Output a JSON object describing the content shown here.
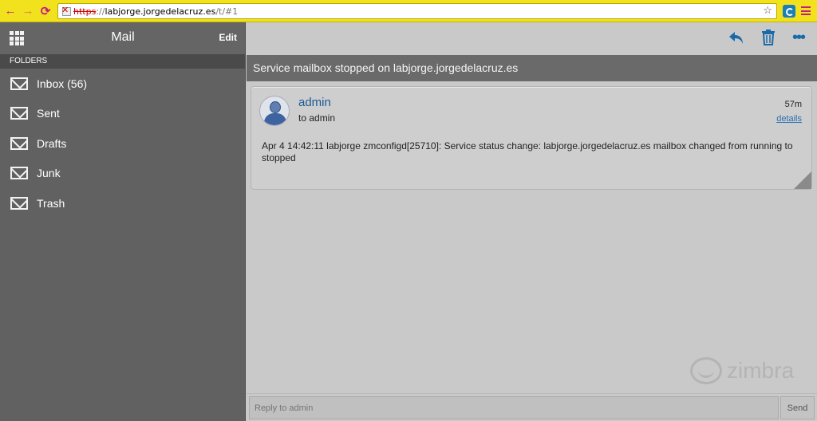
{
  "browser": {
    "url_scheme": "https",
    "url_sep": "://",
    "url_host": "labjorge.jorgedelacruz.es",
    "url_path": "/t/#1",
    "icons": [
      "back-arrow-icon",
      "forward-arrow-icon",
      "reload-icon",
      "security-warning-icon",
      "star-icon",
      "extension-icon",
      "menu-icon"
    ],
    "colors": {
      "chrome": "#f2e21e",
      "accent": "#c1207d"
    }
  },
  "sidebar": {
    "title": "Mail",
    "edit_label": "Edit",
    "folders_label": "FOLDERS",
    "folders": [
      {
        "label": "Inbox (56)",
        "icon": "envelope-icon"
      },
      {
        "label": "Sent",
        "icon": "envelope-icon"
      },
      {
        "label": "Drafts",
        "icon": "envelope-icon"
      },
      {
        "label": "Junk",
        "icon": "envelope-icon"
      },
      {
        "label": "Trash",
        "icon": "envelope-icon"
      }
    ]
  },
  "toolbar": {
    "icons": [
      "reply-icon",
      "trash-icon",
      "more-icon"
    ],
    "color": "#1a6aa8"
  },
  "message": {
    "subject": "Service mailbox stopped on labjorge.jorgedelacruz.es",
    "sender": "admin",
    "to": "to admin",
    "time": "57m",
    "details": "details",
    "body": "Apr  4 14:42:11 labjorge zmconfigd[25710]: Service status change: labjorge.jorgedelacruz.es mailbox changed from running to stopped"
  },
  "logo": {
    "text": "zimbra"
  },
  "reply": {
    "placeholder": "Reply to admin",
    "send_label": "Send"
  }
}
